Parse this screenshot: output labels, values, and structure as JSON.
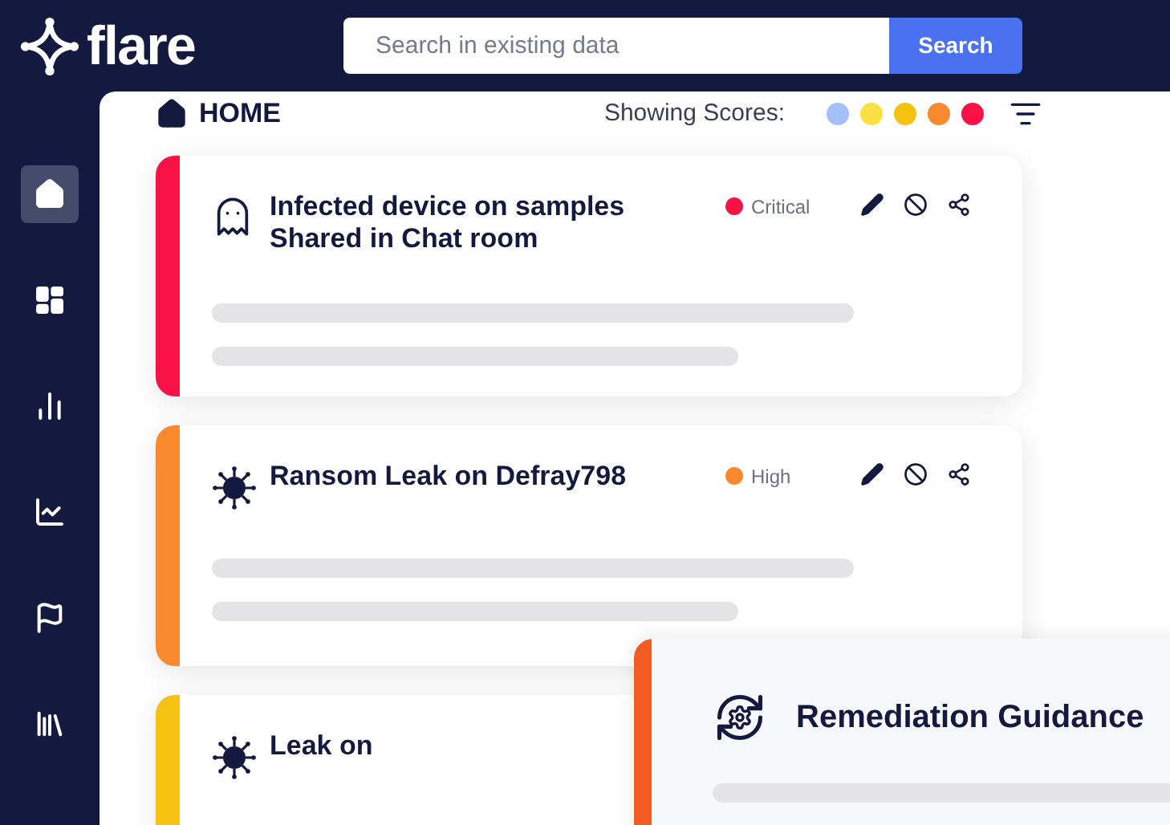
{
  "header": {
    "logo": "flare",
    "search": {
      "placeholder": "Search in existing data",
      "button": "Search"
    }
  },
  "sidebar": {
    "items": [
      {
        "kind": "home",
        "selected": true
      },
      {
        "kind": "dashboard",
        "selected": false
      },
      {
        "kind": "bars",
        "selected": false
      },
      {
        "kind": "line",
        "selected": false
      },
      {
        "kind": "flag",
        "selected": false
      },
      {
        "kind": "library",
        "selected": false
      }
    ]
  },
  "breadcrumb": "HOME",
  "scores": {
    "label": "Showing Scores:",
    "dots": [
      {
        "color": "#a5c0f7"
      },
      {
        "color": "#fbe041"
      },
      {
        "color": "#f5c211"
      },
      {
        "color": "#fb8a2e"
      },
      {
        "color": "#fa1247"
      }
    ]
  },
  "cards": [
    {
      "kind": "ghost",
      "title": "Infected device on samples\nShared in Chat room",
      "severity": "Critical",
      "color": "#fa1247"
    },
    {
      "kind": "virus",
      "title": "Ransom Leak on Defray798",
      "severity": "High",
      "color": "#fb8a2e"
    },
    {
      "kind": "virus",
      "title": "Leak on",
      "color": "#f5c211"
    }
  ],
  "panel": {
    "title": "Remediation Guidance",
    "color": "#f45d22"
  }
}
